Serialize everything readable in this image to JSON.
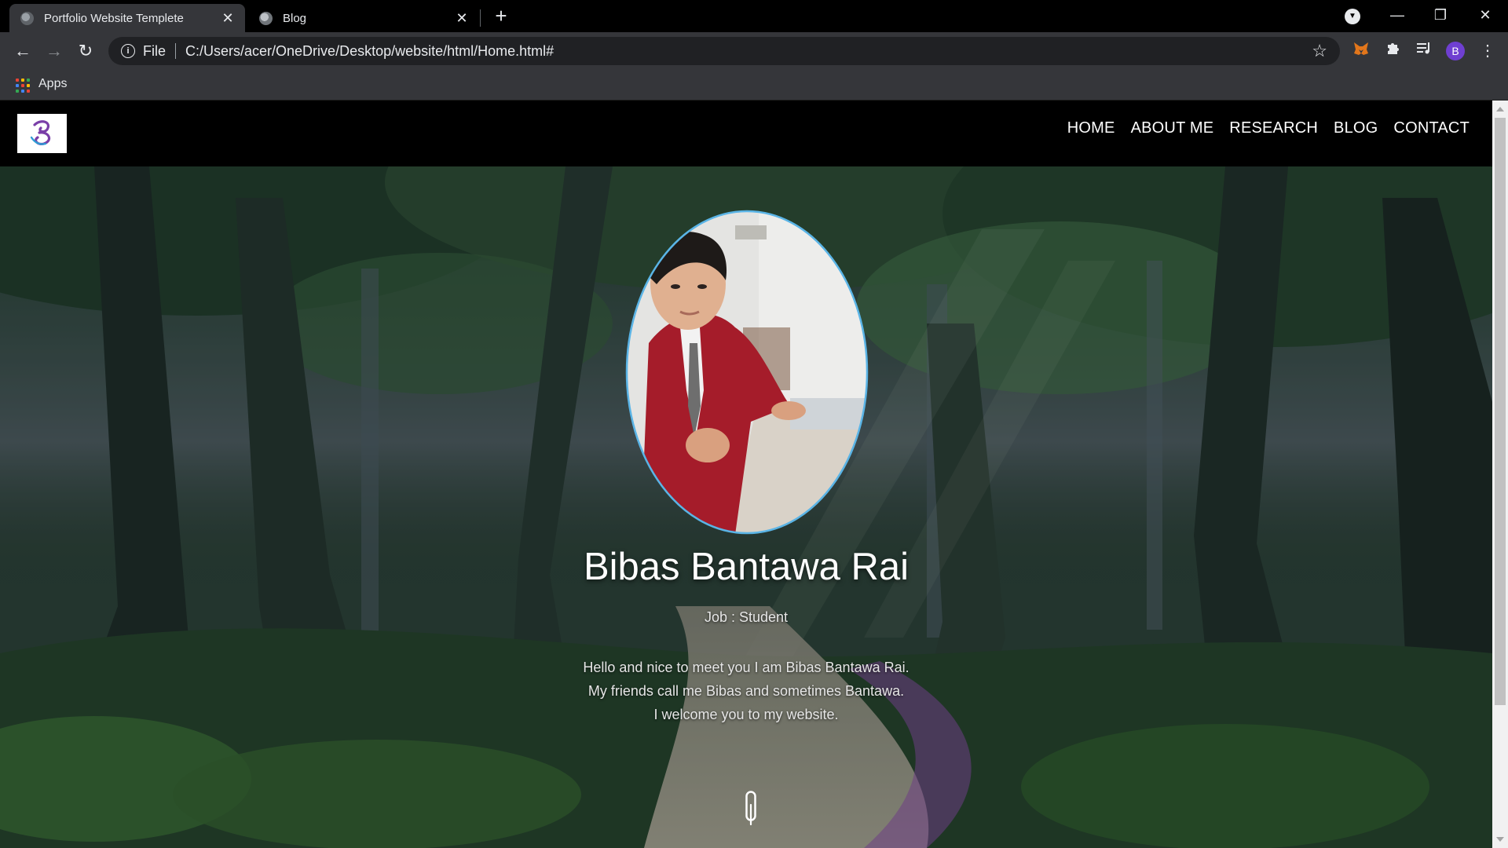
{
  "browser": {
    "tabs": [
      {
        "title": "Portfolio Website Templete",
        "active": true,
        "close": "✕"
      },
      {
        "title": "Blog",
        "active": false,
        "close": "✕"
      }
    ],
    "new_tab": "+",
    "window_controls": {
      "minimize": "—",
      "restore": "❐",
      "close": "✕"
    },
    "tab_search_icon": "chevron-down-icon",
    "nav": {
      "back": "←",
      "forward": "→",
      "reload": "↻"
    },
    "address": {
      "info_icon": "i",
      "scheme": "File",
      "url": "C:/Users/acer/OneDrive/Desktop/website/html/Home.html#",
      "star": "☆"
    },
    "extensions": [
      "metamask-fox-icon",
      "puzzle-icon",
      "media-queue-icon"
    ],
    "profile_initial": "B",
    "menu": "⋮",
    "bookmarks": {
      "apps_label": "Apps"
    }
  },
  "site": {
    "nav": [
      "HOME",
      "ABOUT ME",
      "RESEARCH",
      "BLOG",
      "CONTACT"
    ],
    "hero": {
      "name": "Bibas Bantawa Rai",
      "job": "Job : Student",
      "bio_lines": [
        "Hello and nice to meet you I am Bibas Bantawa Rai.",
        "My friends call me Bibas and sometimes Bantawa.",
        "I welcome you to my website."
      ]
    }
  },
  "colors": {
    "tab_strip": "#000000",
    "toolbar": "#35363a",
    "site_header": "#000000",
    "profile": "#6f3fd1",
    "sweater": "#a51c2a"
  }
}
